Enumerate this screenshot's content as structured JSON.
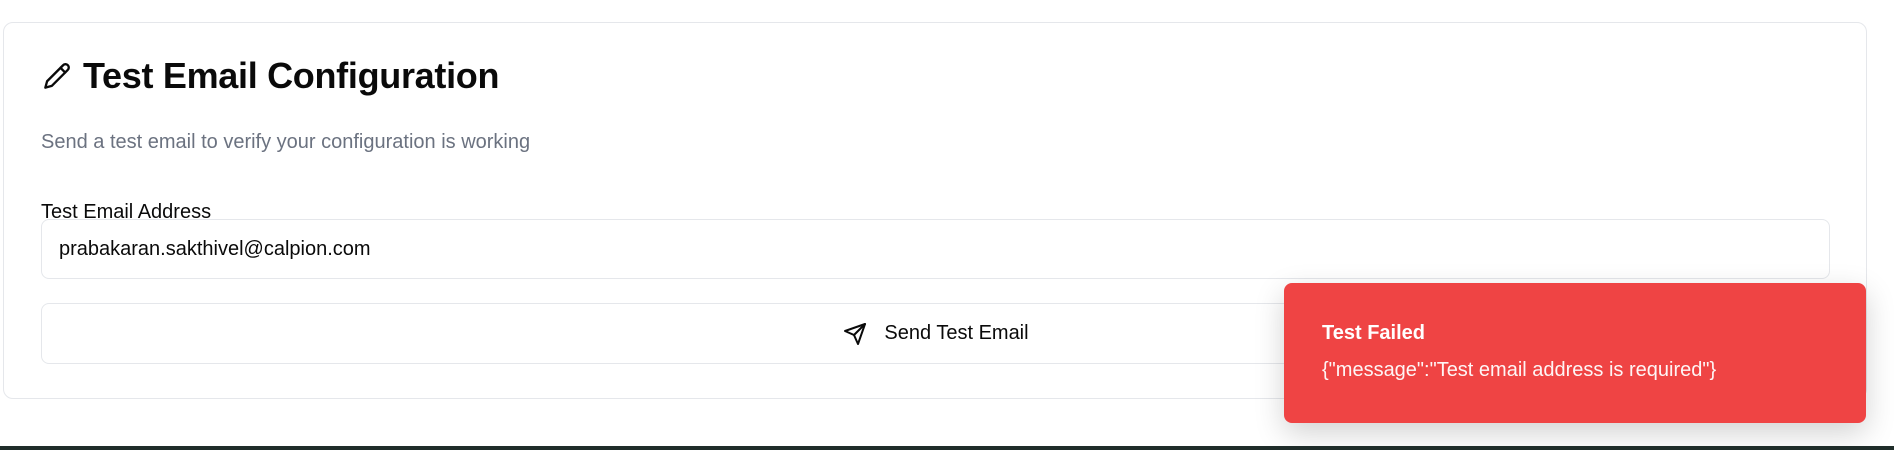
{
  "card": {
    "title": "Test Email Configuration",
    "title_icon": "pencil-icon",
    "subtitle": "Send a test email to verify your configuration is working",
    "email_label": "Test Email Address",
    "email_value": "prabakaran.sakthivel@calpion.com",
    "send_button_label": "Send Test Email",
    "send_button_icon": "send-icon"
  },
  "toast": {
    "title": "Test Failed",
    "message": "{\"message\":\"Test email address is required\"}",
    "color": "#ef4444"
  }
}
